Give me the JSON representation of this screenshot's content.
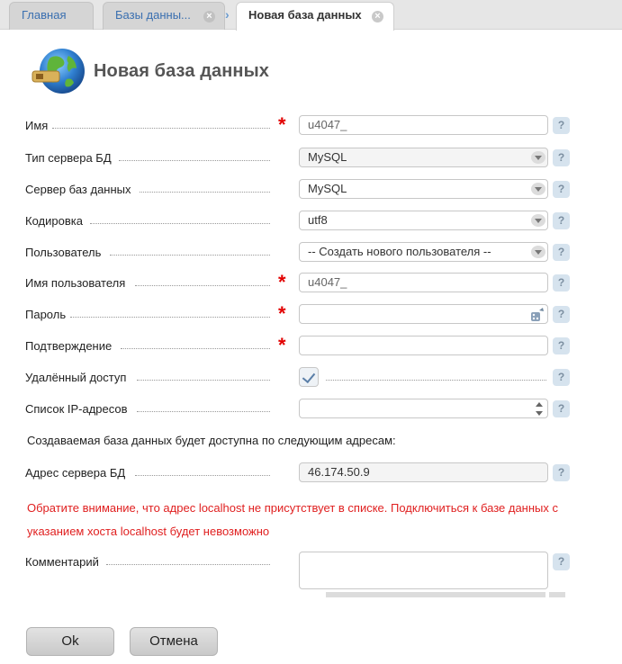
{
  "tabs": [
    {
      "label": "Главная"
    },
    {
      "label": "Базы данны..."
    },
    {
      "label": "Новая база данных"
    }
  ],
  "page": {
    "title": "Новая база данных"
  },
  "form": {
    "name": {
      "label": "Имя",
      "value": "u4047_"
    },
    "server_type": {
      "label": "Тип сервера БД",
      "value": "MySQL"
    },
    "db_server": {
      "label": "Сервер баз данных",
      "value": "MySQL"
    },
    "encoding": {
      "label": "Кодировка",
      "value": "utf8"
    },
    "user": {
      "label": "Пользователь",
      "value": "-- Создать нового пользователя --"
    },
    "username": {
      "label": "Имя пользователя",
      "value": "u4047_"
    },
    "password": {
      "label": "Пароль",
      "value": ""
    },
    "confirm": {
      "label": "Подтверждение",
      "value": ""
    },
    "remote": {
      "label": "Удалённый доступ",
      "checked": true
    },
    "ip_list": {
      "label": "Список IP-адресов",
      "value": ""
    },
    "info_text": "Создаваемая база данных будет доступна по следующим адресам:",
    "server_address": {
      "label": "Адрес сервера БД",
      "value": "46.174.50.9"
    },
    "warning": "Обратите внимание, что адрес localhost не присутствует в списке. Подключиться к базе данных с указанием хоста localhost будет невозможно",
    "comment": {
      "label": "Комментарий",
      "value": ""
    }
  },
  "help_symbol": "?",
  "required_symbol": "*",
  "close_symbol": "×",
  "breadcrumb_sep": "›",
  "buttons": {
    "ok": "Ok",
    "cancel": "Отмена"
  },
  "colors": {
    "required": "#e20000",
    "warning": "#e02020",
    "link": "#3a6fb0"
  }
}
